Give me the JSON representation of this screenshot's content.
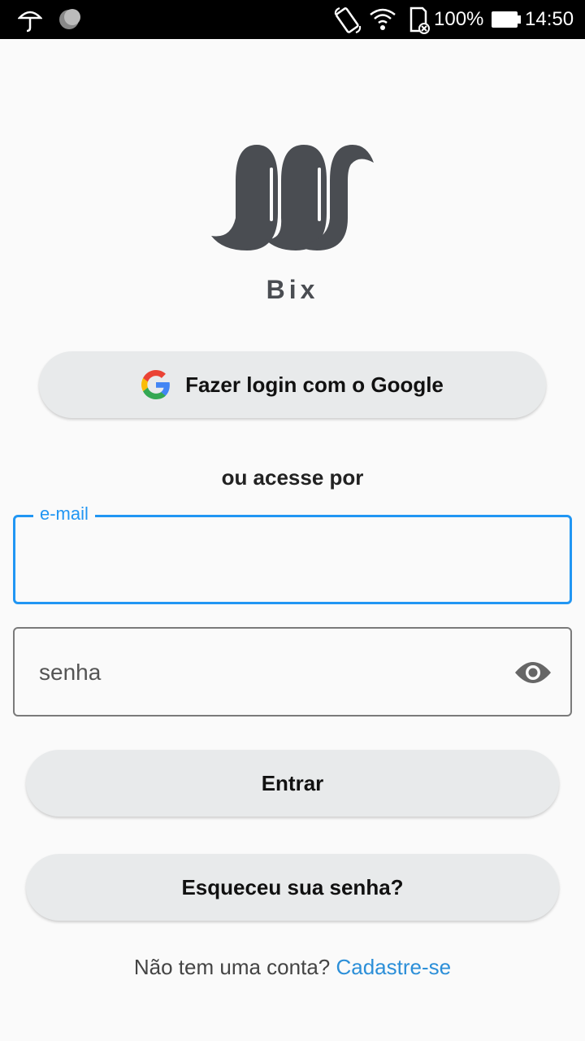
{
  "status_bar": {
    "battery_text": "100%",
    "time": "14:50",
    "icons": [
      "umbrella-icon",
      "moon-icon",
      "rotate-icon",
      "wifi-icon",
      "sd-card-icon",
      "battery-icon"
    ]
  },
  "app": {
    "name": "Bix",
    "logo_color": "#4a4d52"
  },
  "google_button": {
    "label": "Fazer login com o Google",
    "icon": "google-icon"
  },
  "divider_text": "ou acesse por",
  "email_field": {
    "label": "e-mail",
    "value": "",
    "accent_color": "#2196f3"
  },
  "password_field": {
    "placeholder": "senha",
    "icon": "eye-icon"
  },
  "login_button": {
    "label": "Entrar"
  },
  "forgot_button": {
    "label": "Esqueceu sua senha?"
  },
  "signup": {
    "prompt": "Não tem uma conta?",
    "link_label": "Cadastre-se",
    "link_color": "#2c8fd8"
  }
}
